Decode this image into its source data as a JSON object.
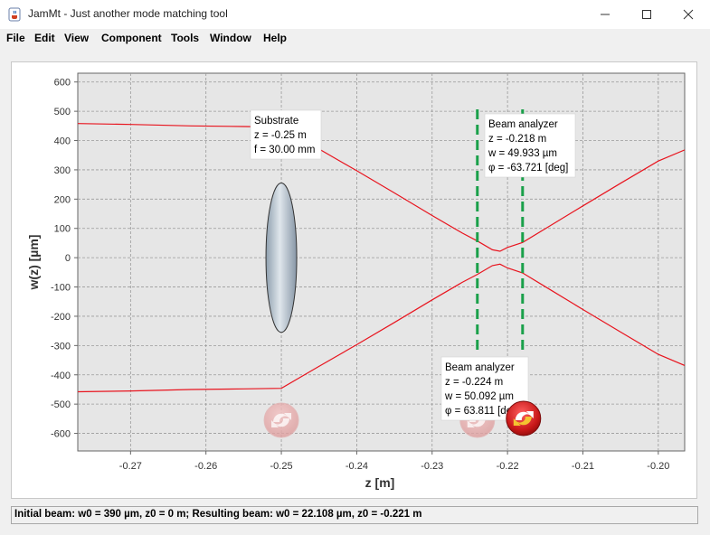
{
  "window": {
    "title": "JamMt - Just another mode matching tool",
    "icon": "java-cup-icon"
  },
  "menu": [
    "File",
    "Edit",
    "View",
    "Component",
    "Tools",
    "Window",
    "Help"
  ],
  "status": "Initial beam: w0 = 390 µm, z0 = 0 m; Resulting beam: w0 = 22.108 µm, z0 = -0.221 m",
  "annotations": {
    "substrate": [
      "Substrate",
      "z = -0.25 m",
      "f = 30.00 mm"
    ],
    "beam_analyzer_1": [
      "Beam analyzer",
      "z = -0.218 m",
      "w = 49.933 µm",
      "φ = -63.721 [deg]"
    ],
    "beam_analyzer_2": [
      "Beam analyzer",
      "z = -0.224 m",
      "w = 50.092 µm",
      "φ = 63.811 [deg]"
    ]
  },
  "chart_data": {
    "type": "line",
    "xlabel": "z [m]",
    "ylabel": "w(z) [µm]",
    "xlim": [
      -0.277,
      -0.1965
    ],
    "ylim": [
      -660,
      630
    ],
    "xticks": [
      -0.27,
      -0.26,
      -0.25,
      -0.24,
      -0.23,
      -0.22,
      -0.21,
      -0.2
    ],
    "xtick_labels": [
      "-0.27",
      "-0.26",
      "-0.25",
      "-0.24",
      "-0.23",
      "-0.22",
      "-0.21",
      "-0.20"
    ],
    "yticks": [
      600,
      500,
      400,
      300,
      200,
      100,
      0,
      -100,
      -200,
      -300,
      -400,
      -500,
      -600
    ],
    "grid": true,
    "series": [
      {
        "color": "#e8141e",
        "x": [
          -0.277,
          -0.27,
          -0.262,
          -0.255,
          -0.25,
          -0.245,
          -0.24,
          -0.235,
          -0.23,
          -0.226,
          -0.224,
          -0.222,
          -0.221,
          -0.22,
          -0.218,
          -0.215,
          -0.21,
          -0.205,
          -0.2,
          -0.1965
        ],
        "y": [
          458,
          455,
          450,
          448,
          446,
          371,
          297,
          221,
          144,
          84,
          57,
          27,
          22,
          35,
          52,
          99,
          177,
          254,
          330,
          368
        ]
      },
      {
        "color": "#e8141e",
        "x": [
          -0.277,
          -0.27,
          -0.262,
          -0.255,
          -0.25,
          -0.245,
          -0.24,
          -0.235,
          -0.23,
          -0.226,
          -0.224,
          -0.222,
          -0.221,
          -0.22,
          -0.218,
          -0.215,
          -0.21,
          -0.205,
          -0.2,
          -0.1965
        ],
        "y": [
          -458,
          -455,
          -450,
          -448,
          -446,
          -371,
          -297,
          -221,
          -144,
          -84,
          -57,
          -27,
          -22,
          -35,
          -52,
          -99,
          -177,
          -254,
          -330,
          -368
        ]
      }
    ],
    "components": [
      {
        "kind": "lens",
        "z": -0.25,
        "halfheight": 255
      },
      {
        "kind": "beam-analyzer",
        "z": -0.218,
        "color": "#1aa04a"
      },
      {
        "kind": "beam-analyzer",
        "z": -0.224,
        "color": "#1aa04a"
      }
    ]
  }
}
